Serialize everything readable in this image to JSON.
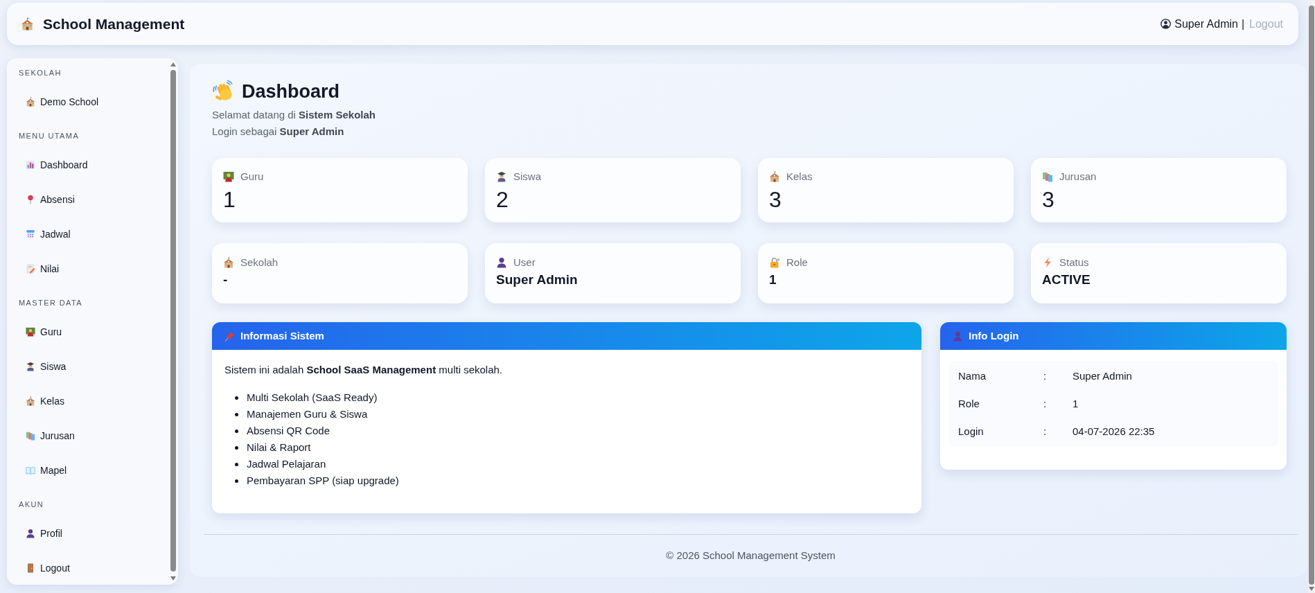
{
  "header": {
    "title": "School Management",
    "user": "Super Admin",
    "separator": "|",
    "logout": "Logout"
  },
  "sidebar": {
    "sections": [
      {
        "title": "SEKOLAH",
        "items": [
          {
            "label": "Demo School",
            "selected": false
          }
        ]
      },
      {
        "title": "MENU UTAMA",
        "items": [
          {
            "label": "Dashboard",
            "selected": false
          },
          {
            "label": "Absensi",
            "selected": false
          },
          {
            "label": "Jadwal",
            "selected": false
          },
          {
            "label": "Nilai",
            "selected": false
          }
        ]
      },
      {
        "title": "MASTER DATA",
        "items": [
          {
            "label": "Guru",
            "selected": false
          },
          {
            "label": "Siswa",
            "selected": false
          },
          {
            "label": "Kelas",
            "selected": false
          },
          {
            "label": "Jurusan",
            "selected": false
          },
          {
            "label": "Mapel",
            "selected": false
          }
        ]
      },
      {
        "title": "AKUN",
        "items": [
          {
            "label": "Profil",
            "selected": false
          },
          {
            "label": "Logout",
            "selected": false
          }
        ]
      }
    ]
  },
  "page": {
    "title": "Dashboard",
    "intro": [
      "Selamat datang di **Sistem Sekolah**",
      "Login sebagai **Super Admin**"
    ]
  },
  "count_cards": [
    {
      "label": "Guru",
      "value": "1"
    },
    {
      "label": "Siswa",
      "value": "2"
    },
    {
      "label": "Kelas",
      "value": "3"
    },
    {
      "label": "Jurusan",
      "value": "3"
    }
  ],
  "detail_cards": [
    {
      "label": "Sekolah",
      "value": "-"
    },
    {
      "label": "User",
      "value": "Super Admin"
    },
    {
      "label": "Role",
      "value": "1"
    },
    {
      "label": "Status",
      "value": "ACTIVE"
    }
  ],
  "system_info": {
    "title": "Informasi Sistem",
    "text": "Sistem ini adalah **School SaaS Management** multi sekolah.",
    "features": [
      "Multi Sekolah (SaaS Ready)",
      "Manajemen Guru & Siswa",
      "Absensi QR Code",
      "Nilai & Raport",
      "Jadwal Pelajaran",
      "Pembayaran SPP (siap upgrade)"
    ]
  },
  "login_info": {
    "title": "Info Login",
    "rows": [
      {
        "label": "Nama",
        "separator": ":",
        "value": "Super Admin"
      },
      {
        "label": "Role",
        "separator": ":",
        "value": "1"
      },
      {
        "label": "Login",
        "separator": ":",
        "value": "04-07-2026 22:35"
      }
    ]
  },
  "footer": {
    "text": "© 2026 School Management System"
  }
}
